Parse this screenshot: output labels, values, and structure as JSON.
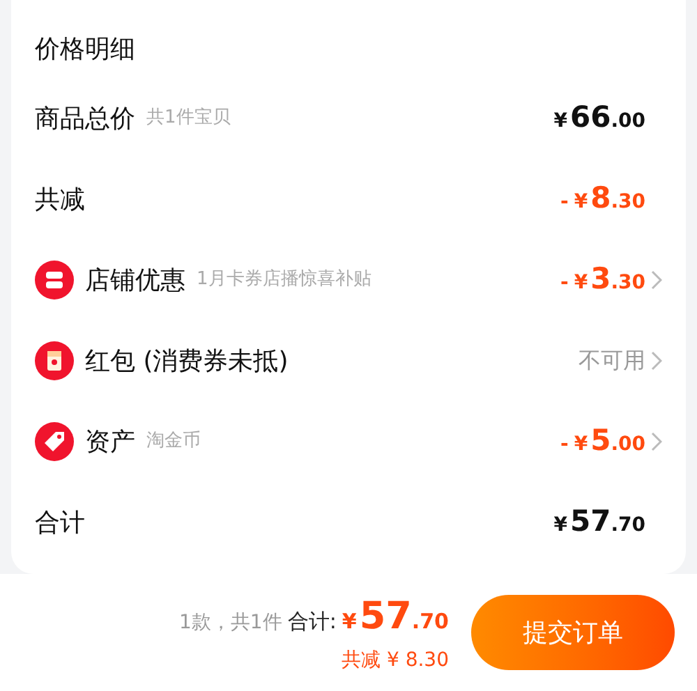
{
  "title": "价格明细",
  "rows": [
    {
      "kind": "price",
      "label": "商品总价",
      "note": "共1件宝贝",
      "amount": {
        "currency": "¥",
        "integer": "66",
        "decimal": ".00"
      },
      "chevron": false
    },
    {
      "kind": "discount",
      "label": "共减",
      "amount": {
        "sign": "-",
        "currency": "¥",
        "integer": "8",
        "decimal": ".30"
      },
      "chevron": false
    },
    {
      "kind": "shop",
      "label": "店铺优惠",
      "note": "1月卡券店播惊喜补贴",
      "amount": {
        "sign": "-",
        "currency": "¥",
        "integer": "3",
        "decimal": ".30"
      },
      "chevron": true
    },
    {
      "kind": "envelope",
      "label": "红包 (消费券未抵)",
      "status": "不可用",
      "chevron": true
    },
    {
      "kind": "asset",
      "label": "资产",
      "note": "淘金币",
      "amount": {
        "sign": "-",
        "currency": "¥",
        "integer": "5",
        "decimal": ".00"
      },
      "chevron": true
    },
    {
      "kind": "price",
      "label": "合计",
      "amount": {
        "currency": "¥",
        "integer": "57",
        "decimal": ".70"
      },
      "chevron": false
    }
  ],
  "footer": {
    "count": "1款，共1件",
    "total_label": "合计:",
    "total": {
      "currency": "¥",
      "integer": "57",
      "decimal": ".70"
    },
    "saving": "共减 ¥ 8.30",
    "submit": "提交订单"
  }
}
